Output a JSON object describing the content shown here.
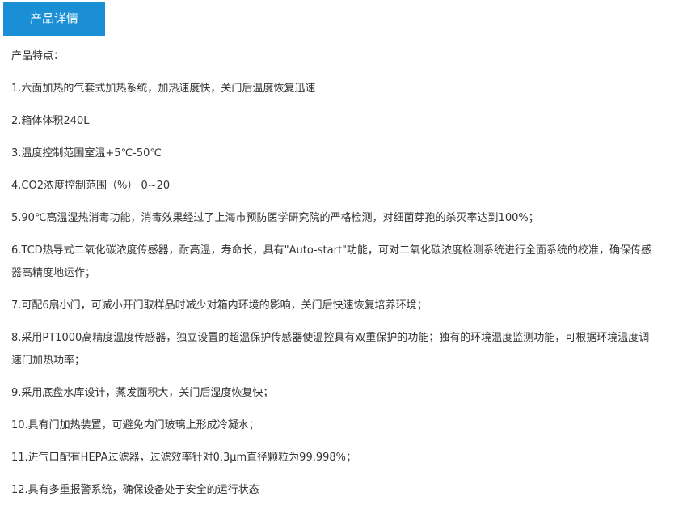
{
  "header": {
    "tab_label": "产品详情"
  },
  "content": {
    "intro": "产品特点：",
    "items": [
      "1.六面加热的气套式加热系统，加热速度快，关门后温度恢复迅速",
      "2.箱体体积240L",
      "3.温度控制范围室温+5℃-50℃",
      "4.CO2浓度控制范围（%） 0~20",
      "5.90℃高温湿热消毒功能，消毒效果经过了上海市预防医学研究院的严格检测，对细菌芽孢的杀灭率达到100%；",
      "6.TCD热导式二氧化碳浓度传感器，耐高温，寿命长，具有\"Auto-start\"功能，可对二氧化碳浓度检测系统进行全面系统的校准，确保传感器高精度地运作；",
      "7.可配6扇小门，可减小开门取样品时减少对箱内环境的影响，关门后快速恢复培养环境；",
      "8.采用PT1000高精度温度传感器，独立设置的超温保护传感器使温控具有双重保护的功能；独有的环境温度监测功能，可根据环境温度调速门加热功率；",
      "9.采用底盘水库设计，蒸发面积大，关门后湿度恢复快；",
      "10.具有门加热装置，可避免内门玻璃上形成冷凝水；",
      "11.进气口配有HEPA过滤器，过滤效率针对0.3μm直径颗粒为99.998%；",
      "12.具有多重报警系统，确保设备处于安全的运行状态"
    ]
  }
}
